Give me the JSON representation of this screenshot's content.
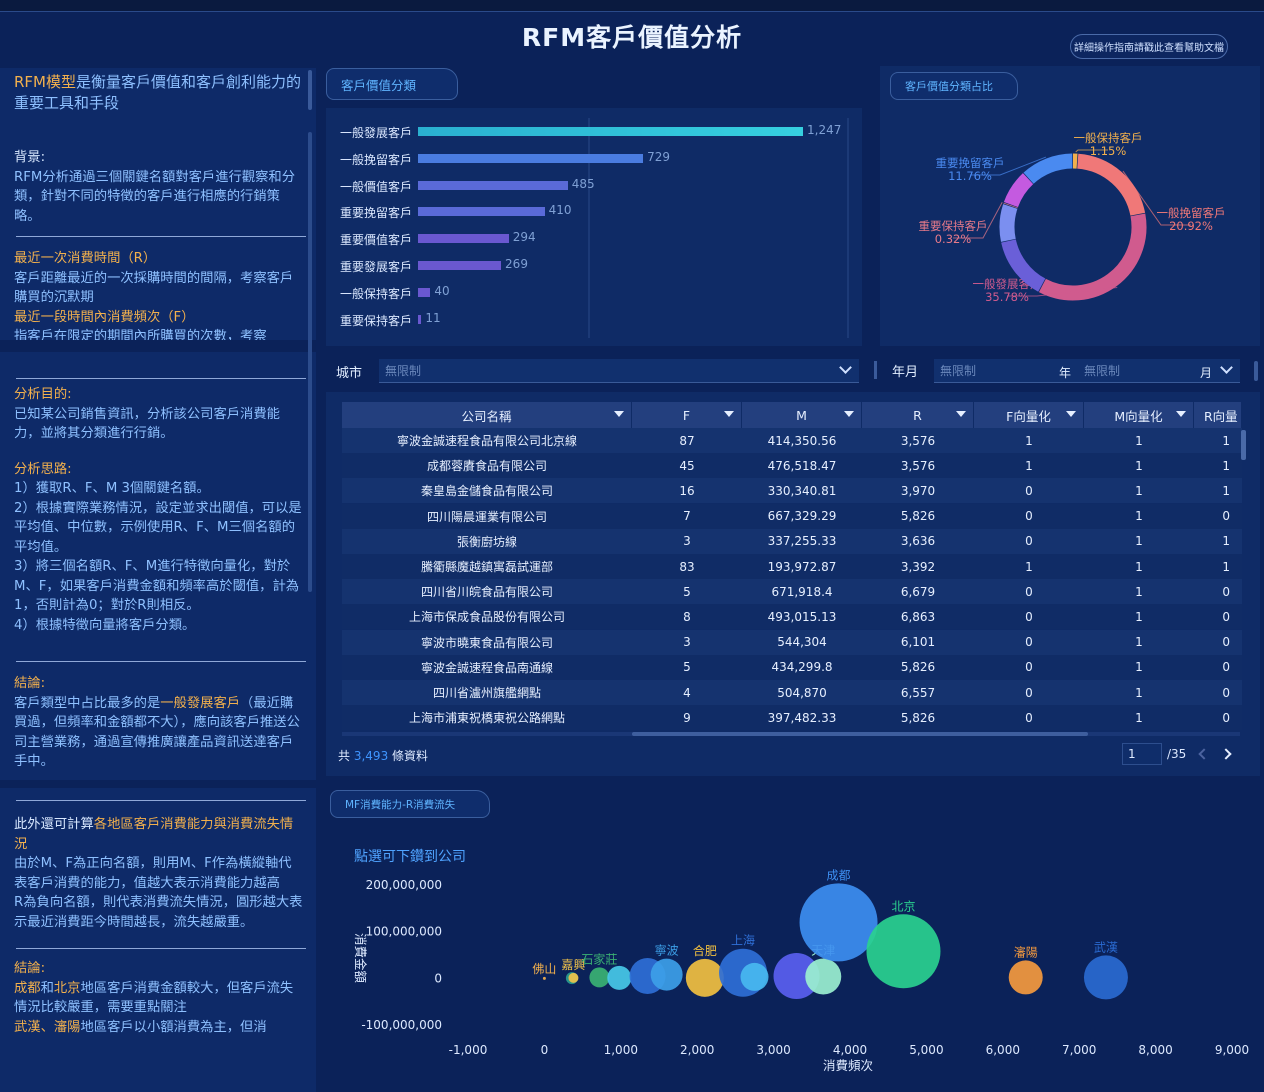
{
  "title": "RFM客戶價值分析",
  "help_button": "詳細操作指南請戳此查看幫助文檔",
  "left_panel": {
    "intro_accent": "RFM模型",
    "intro_rest": "是衡量客戶價值和客戶創利能力的重要工具和手段",
    "bg_head": "背景:",
    "bg_text": "RFM分析通過三個關鍵名額對客戶進行觀察和分類，針對不同的特徵的客戶進行相應的行銷策略。",
    "r_head": "最近一次消費時間（R）",
    "r_text": "客戶距離最近的一次採購時間的間隔，考察客戶購買的沉默期",
    "f_head": "最近一段時間內消費頻次（F）",
    "f_text_partial": "指客戶在限定的期間內所購買的次數，考察",
    "goal_head": "分析目的:",
    "goal_text": "已知某公司銷售資訊，分析該公司客戶消費能力，並將其分類進行行銷。",
    "idea_head": "分析思路:",
    "idea_1": "1）獲取R、F、M 3個關鍵名額。",
    "idea_2": "2）根據實際業務情況，設定並求出閾值，可以是平均值、中位數，示例使用R、F、M三個名額的平均值。",
    "idea_3": "3）將三個名額R、F、M進行特徵向量化，對於M、F，如果客戶消費金額和頻率高於閾值，計為1，否則計為0；對於R則相反。",
    "idea_4": "4）根據特徵向量將客戶分類。",
    "concl_head": "結論:",
    "concl_a": "客戶類型中占比最多的是",
    "concl_accent": "一般發展客戶",
    "concl_b": "（最近購買過，但頻率和金額都不大），應向該客戶推送公司主營業務，通過宣傳推廣讓產品資訊送達客戶手中。",
    "extra_a": "此外還可計算",
    "extra_accent": "各地區客戶消費能力與消費流失情況",
    "extra_b1": "由於M、F為正向名額，則用M、F作為橫縱軸代表客戶消費的能力，值越大表示消費能力越高",
    "extra_b2": "R為負向名額，則代表消費流失情況，圓形越大表示最近消費距今時間越長，流失越嚴重。",
    "concl2_head": "結論:",
    "concl2_c1": "成都",
    "concl2_and": "和",
    "concl2_c2": "北京",
    "concl2_rest": "地區客戶消費金額較大，但客戶流失情況比較嚴重，需要重點關注",
    "concl2_c3": "武漢、瀋陽",
    "concl2_rest2": "地區客戶以小額消費為主，但消"
  },
  "bar_panel": {
    "tab": "客戶價值分類",
    "rows": [
      {
        "label": "一般發展客戶",
        "value": 1247,
        "text": "1,247"
      },
      {
        "label": "一般挽留客戶",
        "value": 729,
        "text": "729"
      },
      {
        "label": "一般價值客戶",
        "value": 485,
        "text": "485"
      },
      {
        "label": "重要挽留客戶",
        "value": 410,
        "text": "410"
      },
      {
        "label": "重要價值客戶",
        "value": 294,
        "text": "294"
      },
      {
        "label": "重要發展客戶",
        "value": 269,
        "text": "269"
      },
      {
        "label": "一般保持客戶",
        "value": 40,
        "text": "40"
      },
      {
        "label": "重要保持客戶",
        "value": 11,
        "text": "11"
      }
    ]
  },
  "donut_panel": {
    "tab": "客戶價值分類占比",
    "slices": [
      {
        "name": "一般保持客戶",
        "pct": "1.15%",
        "value": 1.15,
        "color": "#f2b04d"
      },
      {
        "name": "一般挽留客戶",
        "pct": "20.92%",
        "value": 20.92,
        "color": "#f07878"
      },
      {
        "name": "一般發展客戶",
        "pct": "35.78%",
        "value": 35.78,
        "color": "#d05b8e"
      },
      {
        "name": "一般價值客戶",
        "pct": "",
        "value": 13.92,
        "color": "#6a5fd8"
      },
      {
        "name": "重要價值客戶",
        "pct": "",
        "value": 8.44,
        "color": "#7b8ff0"
      },
      {
        "name": "重要保持客戶",
        "pct": "0.32%",
        "value": 0.32,
        "color": "#e87a8a"
      },
      {
        "name": "重要發展客戶",
        "pct": "",
        "value": 7.72,
        "color": "#c45ae0"
      },
      {
        "name": "重要挽留客戶",
        "pct": "11.76%",
        "value": 11.76,
        "color": "#4a8af0"
      }
    ]
  },
  "filters": {
    "city_label": "城市",
    "city_value": "無限制",
    "ym_label": "年月",
    "year_value": "無限制",
    "year_unit": "年",
    "month_value": "無限制",
    "month_unit": "月"
  },
  "table": {
    "columns": [
      "公司名稱",
      "F",
      "M",
      "R",
      "F向量化",
      "M向量化",
      "R向量"
    ],
    "rows": [
      [
        "寧波金誠速程食品有限公司北京線",
        "87",
        "414,350.56",
        "3,576",
        "1",
        "1",
        "1"
      ],
      [
        "成都蓉賡食品有限公司",
        "45",
        "476,518.47",
        "3,576",
        "1",
        "1",
        "1"
      ],
      [
        "秦皇島金儲食品有限公司",
        "16",
        "330,340.81",
        "3,970",
        "0",
        "1",
        "1"
      ],
      [
        "四川陽晨運業有限公司",
        "7",
        "667,329.29",
        "5,826",
        "0",
        "1",
        "0"
      ],
      [
        "張衡廚坊線",
        "3",
        "337,255.33",
        "3,636",
        "0",
        "1",
        "1"
      ],
      [
        "騰衢縣魔越鎮寓磊試運部",
        "83",
        "193,972.87",
        "3,392",
        "1",
        "1",
        "1"
      ],
      [
        "四川省川皖食品有限公司",
        "5",
        "671,918.4",
        "6,679",
        "0",
        "1",
        "0"
      ],
      [
        "上海市保成食品股份有限公司",
        "8",
        "493,015.13",
        "6,863",
        "0",
        "1",
        "0"
      ],
      [
        "寧波市曉東食品有限公司",
        "3",
        "544,304",
        "6,101",
        "0",
        "1",
        "0"
      ],
      [
        "寧波金誠速程食品南通線",
        "5",
        "434,299.8",
        "5,826",
        "0",
        "1",
        "0"
      ],
      [
        "四川省瀘州旗艦網點",
        "4",
        "504,870",
        "6,557",
        "0",
        "1",
        "0"
      ],
      [
        "上海市浦東祝橋東祝公路網點",
        "9",
        "397,482.33",
        "5,826",
        "0",
        "1",
        "0"
      ]
    ],
    "total_prefix": "共",
    "total_count": "3,493",
    "total_suffix": "條資料",
    "page": "1",
    "page_total": "/35"
  },
  "bubble_panel": {
    "tab": "MF消費能力-R消費流失",
    "subtitle": "點選可下鑽到公司",
    "chart_data": {
      "type": "scatter",
      "xlabel": "消費頻次",
      "ylabel": "消費金額",
      "xlim": [
        -1000,
        9000
      ],
      "ylim": [
        -100000000,
        200000000
      ],
      "xticks": [
        "-1,000",
        "0",
        "1,000",
        "2,000",
        "3,000",
        "4,000",
        "5,000",
        "6,000",
        "7,000",
        "8,000",
        "9,000"
      ],
      "yticks": [
        "200,000,000",
        "100,000,000",
        "0",
        "-100,000,000"
      ],
      "points": [
        {
          "name": "佛山",
          "x": 0,
          "y": 0,
          "r": 1.5,
          "color": "#f2b04d"
        },
        {
          "name": "",
          "x": 360,
          "y": 500000,
          "r": 6,
          "color": "#2a9d8f"
        },
        {
          "name": "嘉興",
          "x": 380,
          "y": 1000000,
          "r": 5,
          "color": "#f0c24a"
        },
        {
          "name": "石家莊",
          "x": 720,
          "y": 2000000,
          "r": 10,
          "color": "#3bb273"
        },
        {
          "name": "",
          "x": 980,
          "y": 1000000,
          "r": 12,
          "color": "#48c9e8"
        },
        {
          "name": "",
          "x": 1350,
          "y": 5000000,
          "r": 18,
          "color": "#2f6fd6"
        },
        {
          "name": "寧波",
          "x": 1600,
          "y": 8000000,
          "r": 16,
          "color": "#3da0e8"
        },
        {
          "name": "合肥",
          "x": 2100,
          "y": 1000000,
          "r": 19,
          "color": "#f2c040"
        },
        {
          "name": "上海",
          "x": 2600,
          "y": 12000000,
          "r": 24,
          "color": "#2f6fd6"
        },
        {
          "name": "",
          "x": 2750,
          "y": 3000000,
          "r": 14,
          "color": "#48b8f0"
        },
        {
          "name": "",
          "x": 3300,
          "y": 5000000,
          "r": 23,
          "color": "#5a5ff0"
        },
        {
          "name": "天津",
          "x": 3650,
          "y": 4000000,
          "r": 18,
          "color": "#9bf0d0"
        },
        {
          "name": "成都",
          "x": 3850,
          "y": 120000000,
          "r": 39,
          "color": "#3d8ef0"
        },
        {
          "name": "北京",
          "x": 4700,
          "y": 58000000,
          "r": 37,
          "color": "#2ad18f"
        },
        {
          "name": "瀋陽",
          "x": 6300,
          "y": 2000000,
          "r": 17,
          "color": "#f59a3e"
        },
        {
          "name": "武漢",
          "x": 7350,
          "y": 2000000,
          "r": 22,
          "color": "#2a6ad0"
        }
      ]
    }
  }
}
